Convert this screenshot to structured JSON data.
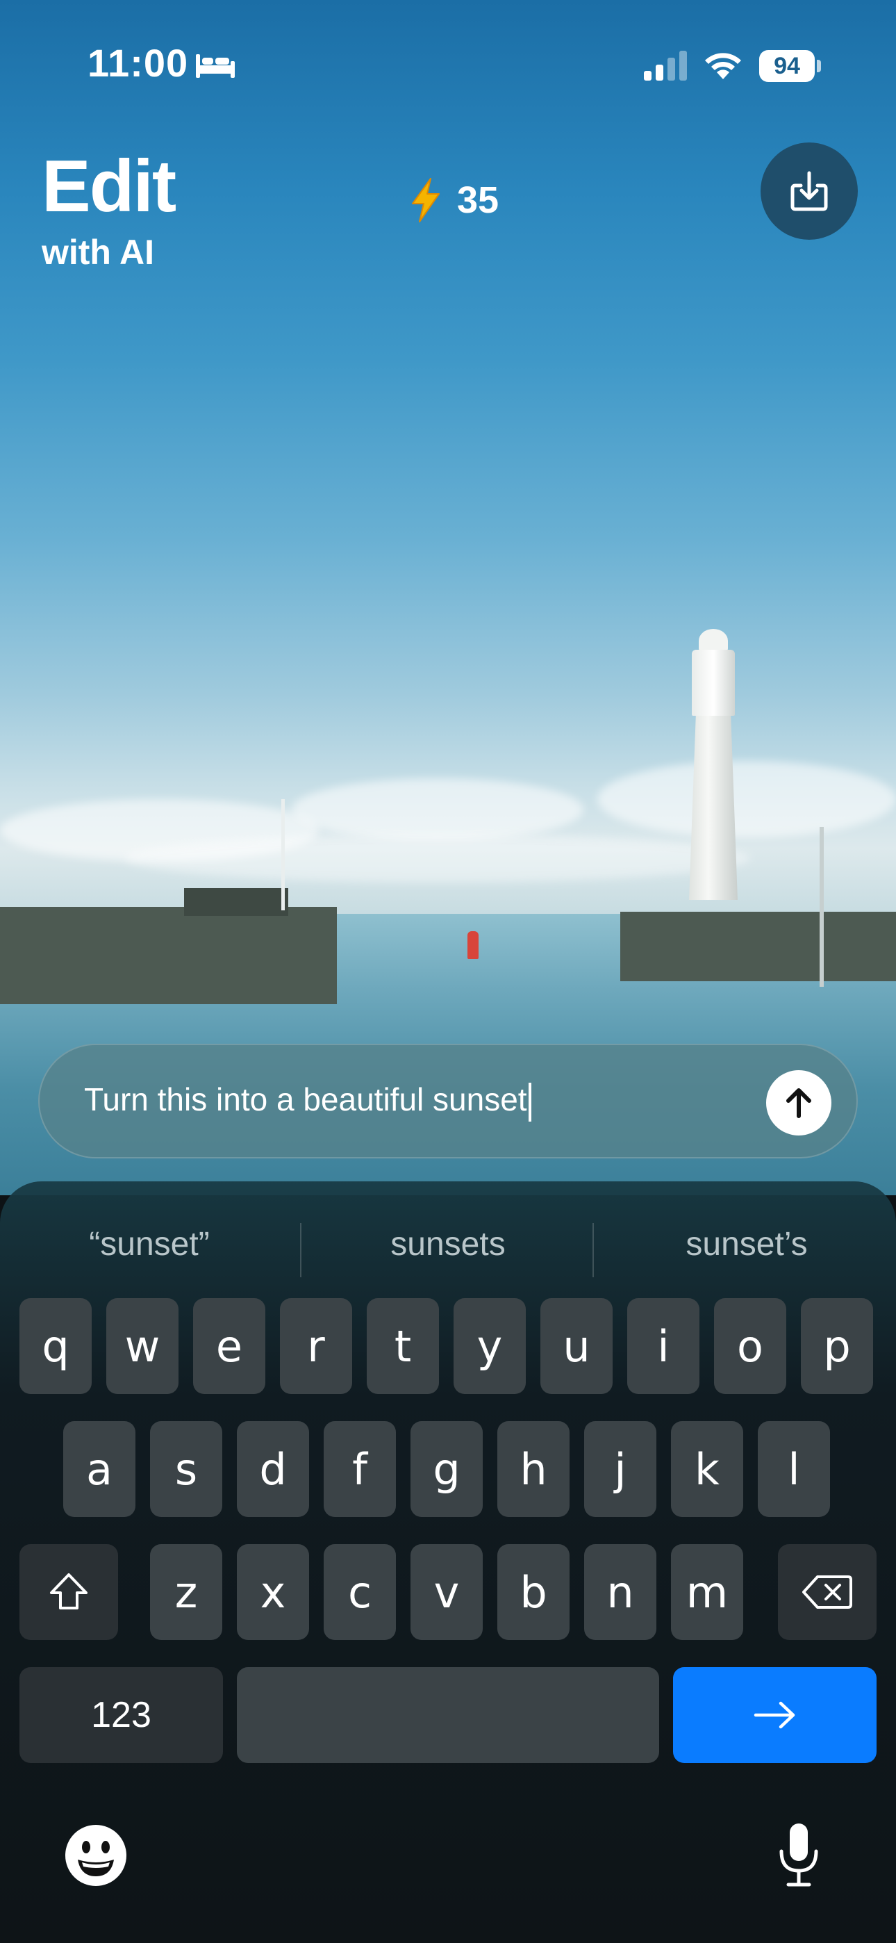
{
  "status_bar": {
    "time": "11:00",
    "focus_icon": "bed-icon",
    "signal_icon": "signal-icon",
    "wifi_icon": "wifi-icon",
    "battery_level": "94"
  },
  "header": {
    "title": "Edit",
    "subtitle": "with AI",
    "credits_icon": "lightning-bolt-icon",
    "credits_value": "35",
    "download_icon": "download-icon"
  },
  "prompt": {
    "value": "Turn this into a beautiful sunset",
    "send_icon": "arrow-up-icon"
  },
  "keyboard": {
    "suggestions": [
      "“sunset”",
      "sunsets",
      "sunset’s"
    ],
    "row1": [
      "q",
      "w",
      "e",
      "r",
      "t",
      "y",
      "u",
      "i",
      "o",
      "p"
    ],
    "row2": [
      "a",
      "s",
      "d",
      "f",
      "g",
      "h",
      "j",
      "k",
      "l"
    ],
    "row3": [
      "z",
      "x",
      "c",
      "v",
      "b",
      "n",
      "m"
    ],
    "shift_icon": "shift-icon",
    "delete_icon": "backspace-icon",
    "numbers_label": "123",
    "go_icon": "arrow-right-icon",
    "emoji_icon": "emoji-icon",
    "mic_icon": "microphone-icon",
    "go_color": "#0a7cff"
  },
  "colors": {
    "download_button_bg": "#1f4e6b",
    "bolt": "#f5b400",
    "key_bg": "#3b4347"
  }
}
